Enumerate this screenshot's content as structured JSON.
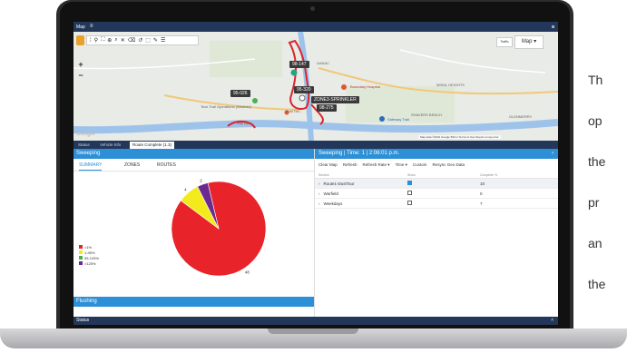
{
  "window": {
    "title": "Map"
  },
  "map": {
    "maptype_label": "Map",
    "traffic_label": "Traffic",
    "markers": [
      "98-147",
      "95-320",
      "95-026",
      "ZONE3-SPRINKLER",
      "98-275"
    ],
    "places": [
      "DANAC",
      "MIRAL HEIGHTS",
      "SHAVERS BENCH",
      "GLENMERRY",
      "Boundary Hospital",
      "Teck Trail Operations (Warfield)",
      "Safeway Trail",
      "Bay Lyn",
      "Trail Tec..."
    ],
    "attribution": "Map data ©2022 Google   500 m    Terms of Use   Report a map error",
    "watermark": "Google"
  },
  "bottom_tabs": [
    "Status",
    "Vehicle Info",
    "Route Complete (1.3)"
  ],
  "left_panel": {
    "title": "Sweeping",
    "subtabs": [
      "SUMMARY",
      "ZONES",
      "ROUTES"
    ],
    "footer": "Flushing"
  },
  "chart_data": {
    "type": "pie",
    "title": "",
    "categories": [
      "<1%",
      "1-95%",
      "95-125%",
      ">125%"
    ],
    "values": [
      48,
      4,
      0,
      2
    ],
    "colors": [
      "#e8232a",
      "#f3ea1d",
      "#4caf50",
      "#6a2a8f"
    ]
  },
  "right_panel": {
    "title": "Sweeping | Time: 1 | 2:06:01 p.m.",
    "toolbar": [
      "Clear Map",
      "Refresh",
      "Refresh Rate",
      "Time",
      "Custom",
      "Resync Geo Data"
    ],
    "columns": [
      "Section",
      "Show",
      "Complete %"
    ],
    "rows": [
      {
        "name": "Route1-DustTour",
        "show": true,
        "complete": "10"
      },
      {
        "name": "Warfield",
        "show": false,
        "complete": "0"
      },
      {
        "name": "Weekdays",
        "show": false,
        "complete": "7"
      }
    ]
  },
  "status_bar": "Status",
  "side_text": [
    "Th",
    "op",
    "the",
    "pr",
    "an",
    "the"
  ]
}
